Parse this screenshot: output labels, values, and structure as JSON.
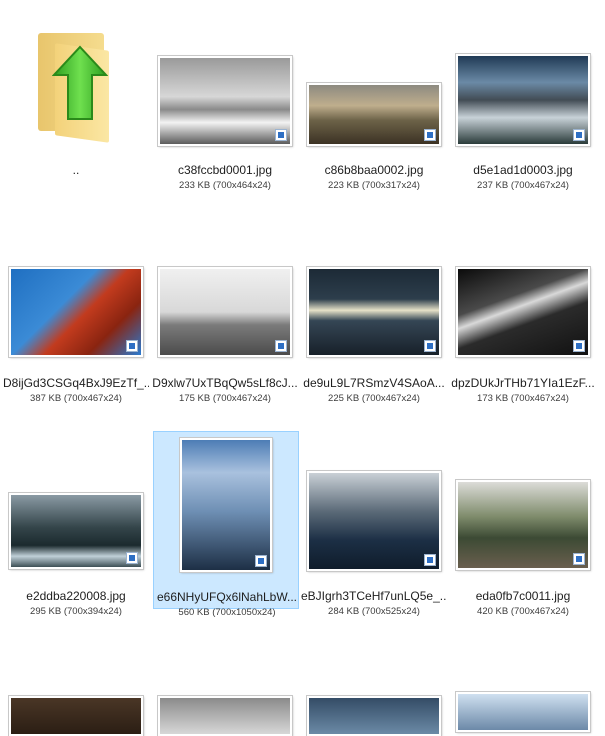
{
  "up_folder": {
    "label": ".."
  },
  "files": [
    {
      "name": "c38fccbd0001.jpg",
      "meta": "233 KB (700x464x24)"
    },
    {
      "name": "c86b8baa0002.jpg",
      "meta": "223 KB (700x317x24)"
    },
    {
      "name": "d5e1ad1d0003.jpg",
      "meta": "237 KB (700x467x24)"
    },
    {
      "name": "D8ijGd3CSGq4BxJ9EzTf_...",
      "meta": "387 KB (700x467x24)"
    },
    {
      "name": "D9xlw7UxTBqQw5sLf8cJ...",
      "meta": "175 KB (700x467x24)"
    },
    {
      "name": "de9uL9L7RSmzV4SAoA...",
      "meta": "225 KB (700x467x24)"
    },
    {
      "name": "dpzDUkJrTHb71YIa1EzF...",
      "meta": "173 KB (700x467x24)"
    },
    {
      "name": "e2ddba220008.jpg",
      "meta": "295 KB (700x394x24)"
    },
    {
      "name": "e66NHyUFQx6lNahLbW...",
      "meta": "560 KB (700x1050x24)"
    },
    {
      "name": "eBJIgrh3TCeHf7unLQ5e_...",
      "meta": "284 KB (700x525x24)"
    },
    {
      "name": "eda0fb7c0011.jpg",
      "meta": "420 KB (700x467x24)"
    }
  ],
  "selected_index": 9,
  "colors": {
    "selection_bg": "#cce8ff",
    "selection_border": "#99d1ff",
    "arrow_green": "#3fbf2a"
  }
}
